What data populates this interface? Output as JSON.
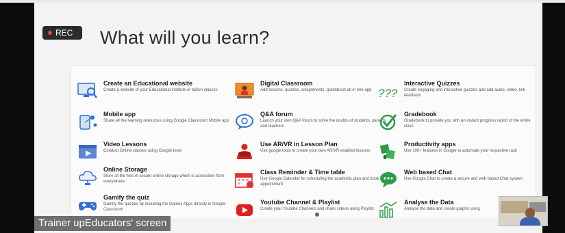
{
  "recording": {
    "label": "REC",
    "dot_color": "#e8453c"
  },
  "slide": {
    "title": "What will you learn?"
  },
  "features": [
    {
      "title": "Create an Educational website",
      "desc": "Create a website of your Educational institute or tuition classes",
      "icon": "website-monitor-icon"
    },
    {
      "title": "Mobile app",
      "desc": "Share all the learning resources using Google Classroom Mobile app",
      "icon": "mobile-app-icon"
    },
    {
      "title": "Video Lessons",
      "desc": "Conduct Online classes using Google tools",
      "icon": "video-lesson-icon"
    },
    {
      "title": "Online Storage",
      "desc": "Store all the files in secure online storage which is accessible from everywhere",
      "icon": "cloud-storage-icon"
    },
    {
      "title": "Gamify the quiz",
      "desc": "Gamify the quizzes by including the Games Apps directly in Google Classroom",
      "icon": "gamepad-icon"
    },
    {
      "title": "Digital Classroom",
      "desc": "Add lessons, quizzes, assignments, gradebook all in one app",
      "icon": "digital-classroom-icon"
    },
    {
      "title": "Q&A forum",
      "desc": "Launch your own Q&A forum to solve the doubts of students, parents and teachers",
      "icon": "chat-bubble-icon"
    },
    {
      "title": "Use AR/VR in Lesson Plan",
      "desc": "Use google tools to create your own AR/VR enabled lessons",
      "icon": "vr-headset-icon"
    },
    {
      "title": "Class Reminder & Time table",
      "desc": "Use Google Calendar for scheduling the academic plan and book the appointment",
      "icon": "calendar-icon"
    },
    {
      "title": "Youtube Channel & Playlist",
      "desc": "Create your Youtube Channels and share videos using Playlist",
      "icon": "youtube-icon"
    },
    {
      "title": "Interactive Quizzes",
      "desc": "Create engaging and interactive quizzes and add audio, video, link feedback",
      "icon": "question-marks-icon"
    },
    {
      "title": "Gradebook",
      "desc": "Gradebook to provide you with an instant progress report of the entire class",
      "icon": "checkmark-circle-icon"
    },
    {
      "title": "Productivity apps",
      "desc": "Use 100+ features in Google to automate your respective task",
      "icon": "productivity-apps-icon"
    },
    {
      "title": "Web based Chat",
      "desc": "Use Google Chat to create a secure and web based Chat system",
      "icon": "chat-icon"
    },
    {
      "title": "Analyse the Data",
      "desc": "Analyse the data and create graphs using",
      "icon": "bar-chart-icon"
    }
  ],
  "caption": {
    "text": "Trainer upEducators' screen"
  },
  "colors": {
    "accent_green": "#2e9b4a",
    "accent_blue": "#2f6fd0",
    "accent_red": "#e03131"
  }
}
